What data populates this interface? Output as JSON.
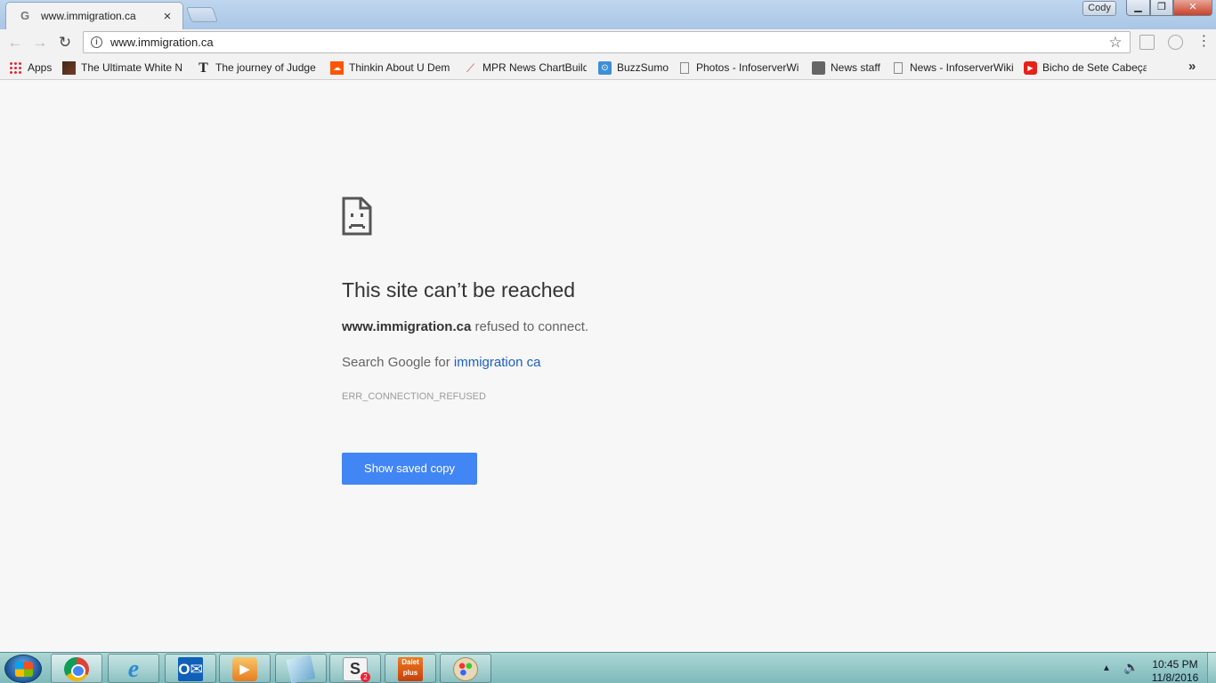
{
  "window": {
    "profile_name": "Cody",
    "minimize_label": "▁",
    "maximize_label": "❐",
    "close_label": "✕"
  },
  "tab": {
    "title": "www.immigration.ca",
    "favicon": "G",
    "close_label": "×"
  },
  "toolbar": {
    "back_label": "←",
    "forward_label": "→",
    "reload_label": "↻",
    "info_label": "i",
    "url": "www.immigration.ca",
    "star_label": "☆",
    "menu_label": "⋮"
  },
  "bookmarks": {
    "items": [
      {
        "label": "Apps",
        "icon": "apps-grid-icon"
      },
      {
        "label": "The Ultimate White N",
        "icon": "ultimate-white-favicon"
      },
      {
        "label": "The journey of Judge",
        "icon": "nyt-t-icon",
        "glyph": "T"
      },
      {
        "label": "Thinkin About U Dem",
        "icon": "soundcloud-icon",
        "glyph": "☁"
      },
      {
        "label": "MPR News ChartBuild",
        "icon": "chart-line-icon",
        "glyph": "⟋"
      },
      {
        "label": "BuzzSumo",
        "icon": "buzzsumo-icon",
        "glyph": "⊙"
      },
      {
        "label": "Photos - InfoserverWi",
        "icon": "page-icon"
      },
      {
        "label": "News staff",
        "icon": "folder-person-icon"
      },
      {
        "label": "News - InfoserverWiki",
        "icon": "page-icon"
      },
      {
        "label": "Bicho de Sete Cabeça",
        "icon": "youtube-icon",
        "glyph": "▶"
      }
    ],
    "more_label": "»"
  },
  "error_page": {
    "heading": "This site can’t be reached",
    "host": "www.immigration.ca",
    "detail_suffix": " refused to connect.",
    "search_prefix": "Search Google for ",
    "search_link": "immigration ca",
    "error_code": "ERR_CONNECTION_REFUSED",
    "button_label": "Show saved copy"
  },
  "taskbar": {
    "apps": [
      {
        "name": "chrome",
        "icon": "chrome-icon"
      },
      {
        "name": "internet-explorer",
        "icon": "ie-icon",
        "glyph": "e"
      },
      {
        "name": "outlook",
        "icon": "outlook-icon",
        "glyph": "O✉"
      },
      {
        "name": "media-player",
        "icon": "media-player-icon",
        "glyph": "▶"
      },
      {
        "name": "notepad",
        "icon": "notepad-icon"
      },
      {
        "name": "slack",
        "icon": "slack-icon",
        "glyph": "S",
        "badge": "2"
      },
      {
        "name": "dalet-plus",
        "icon": "dalet-plus-icon",
        "glyph_top": "Dalet",
        "glyph_bottom": "plus"
      },
      {
        "name": "paint",
        "icon": "paint-palette-icon"
      }
    ],
    "tray_arrow": "▲",
    "volume_glyph": "🔈",
    "time": "10:45 PM",
    "date": "11/8/2016"
  }
}
